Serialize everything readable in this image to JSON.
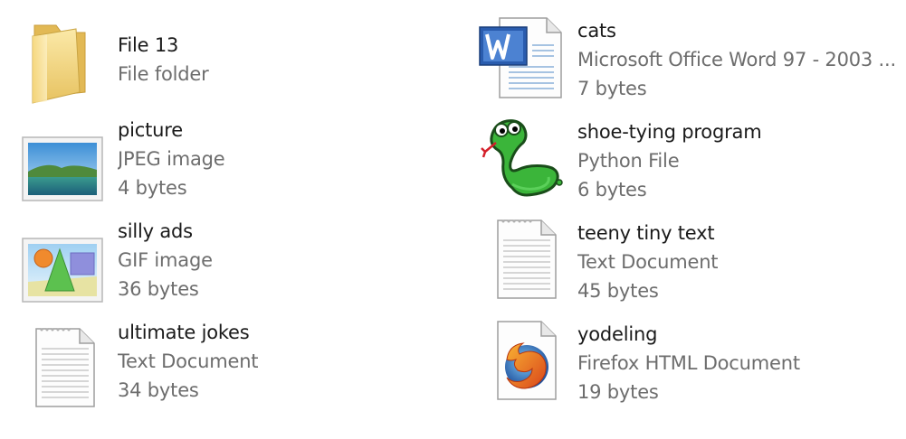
{
  "files": [
    {
      "name": "File 13",
      "type": "File folder",
      "size": "",
      "icon": "folder-icon"
    },
    {
      "name": "picture",
      "type": "JPEG image",
      "size": "4 bytes",
      "icon": "jpeg-image-icon"
    },
    {
      "name": "silly ads",
      "type": "GIF image",
      "size": "36 bytes",
      "icon": "gif-image-icon"
    },
    {
      "name": "ultimate jokes",
      "type": "Text Document",
      "size": "34 bytes",
      "icon": "text-document-icon"
    },
    {
      "name": "cats",
      "type": "Microsoft Office Word 97 - 2003 ...",
      "size": "7 bytes",
      "icon": "word-document-icon"
    },
    {
      "name": "shoe-tying program",
      "type": "Python File",
      "size": "6 bytes",
      "icon": "python-file-icon"
    },
    {
      "name": "teeny tiny text",
      "type": "Text Document",
      "size": "45 bytes",
      "icon": "text-document-icon"
    },
    {
      "name": "yodeling",
      "type": "Firefox HTML Document",
      "size": "19 bytes",
      "icon": "firefox-html-icon"
    }
  ],
  "colors": {
    "name_text": "#1a1a1a",
    "detail_text": "#6d6d6d",
    "background": "#ffffff"
  }
}
